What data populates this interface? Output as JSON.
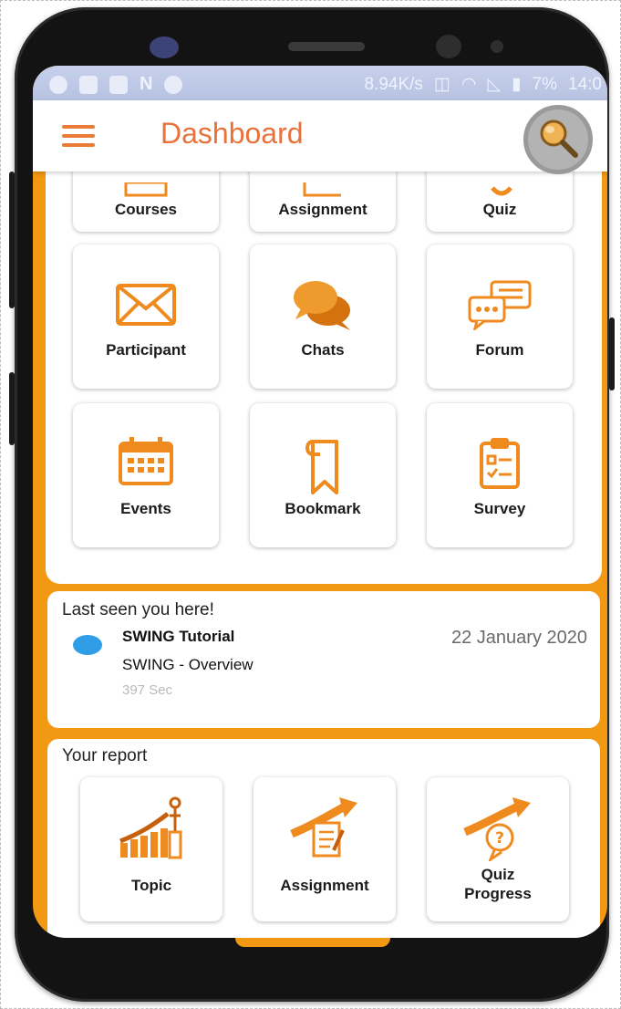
{
  "status_bar": {
    "net_speed": "8.94K/s",
    "battery": "7%",
    "time": "14:0",
    "left_icons": [
      "whatsapp-icon",
      "image-icon",
      "sim-icon",
      "nfc-icon",
      "sync-icon"
    ]
  },
  "app_bar": {
    "title": "Dashboard",
    "menu_icon": "hamburger-menu-icon",
    "search_icon": "search-icon"
  },
  "grid": {
    "row1": [
      {
        "label": "Courses",
        "icon": "courses-icon"
      },
      {
        "label": "Assignment",
        "icon": "assignment-icon"
      },
      {
        "label": "Quiz",
        "icon": "quiz-icon"
      }
    ],
    "row2": [
      {
        "label": "Participant",
        "icon": "envelope-icon"
      },
      {
        "label": "Chats",
        "icon": "chat-bubbles-icon"
      },
      {
        "label": "Forum",
        "icon": "forum-icon"
      }
    ],
    "row3": [
      {
        "label": "Events",
        "icon": "calendar-icon"
      },
      {
        "label": "Bookmark",
        "icon": "bookmark-icon"
      },
      {
        "label": "Survey",
        "icon": "clipboard-icon"
      }
    ]
  },
  "last_seen": {
    "heading": "Last seen you here!",
    "course": "SWING Tutorial",
    "module": "SWING - Overview",
    "duration": "397 Sec",
    "date": "22 January 2020"
  },
  "report": {
    "heading": "Your report",
    "items": [
      {
        "label": "Topic",
        "icon": "growth-chart-icon"
      },
      {
        "label": "Assignment",
        "icon": "assignment-report-icon"
      },
      {
        "label_line1": "Quiz",
        "label_line2": "Progress",
        "icon": "quiz-progress-icon"
      }
    ]
  },
  "colors": {
    "accent": "#f29812",
    "title": "#e7723b",
    "icon_orange": "#ef8a1f",
    "status_bar": "#c7d1ec",
    "dot": "#2f9ee6"
  }
}
